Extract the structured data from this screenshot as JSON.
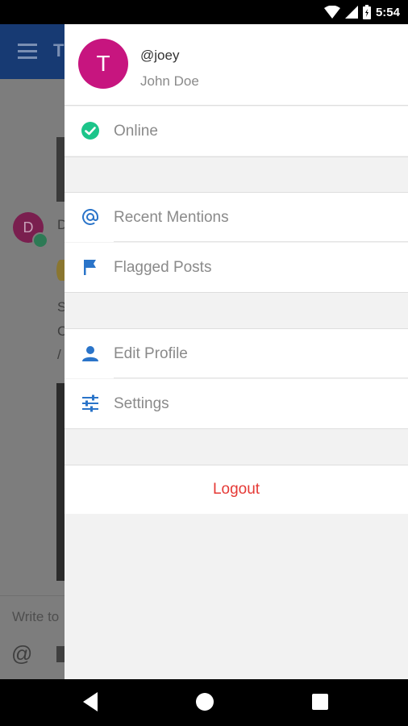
{
  "status_bar": {
    "time": "5:54"
  },
  "background_app": {
    "header_title_fragment": "T",
    "avatar_letter": "D",
    "message_fragments": [
      "D",
      "S",
      "C",
      "/"
    ],
    "composer_placeholder": "Write to",
    "colors": {
      "header": "#173a73",
      "dim_overlay": "#7d7d7d"
    }
  },
  "drawer": {
    "profile": {
      "avatar_letter": "T",
      "username": "@joey",
      "full_name": "John Doe",
      "avatar_color": "#c7157f"
    },
    "status": {
      "label": "Online",
      "icon": "check-circle-icon",
      "color": "#1cc58a"
    },
    "items": [
      {
        "label": "Recent Mentions",
        "icon": "at-icon"
      },
      {
        "label": "Flagged Posts",
        "icon": "flag-icon"
      },
      {
        "label": "Edit Profile",
        "icon": "person-icon"
      },
      {
        "label": "Settings",
        "icon": "sliders-icon"
      }
    ],
    "logout_label": "Logout",
    "colors": {
      "icon": "#2a74c9",
      "logout": "#e53935"
    }
  }
}
